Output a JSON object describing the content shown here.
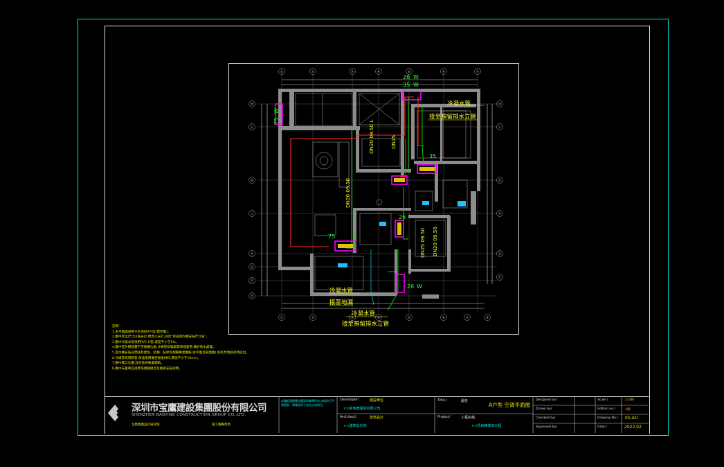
{
  "dimensions": {
    "top_total": "26",
    "top_sub": "35",
    "top_unit_mark": "W",
    "left_vert": "75",
    "left_unit_mark": "W",
    "right_bottom": "26",
    "right_bottom_mark": "W",
    "zone_mid_right": "35",
    "zone_low_left": "75",
    "zone_low_right": "26"
  },
  "grid_labels": {
    "top": [
      "①",
      "②",
      "③",
      "④",
      "⑤",
      "⑥",
      "⑦"
    ],
    "bottom": [
      "①",
      "②",
      "③",
      "④",
      "⑤",
      "⑥",
      "⑦",
      "⑧"
    ],
    "left": [
      "Ⓜ",
      "Ⓛ",
      "Ⓚ",
      "Ⓙ",
      "Ⓗ",
      "Ⓖ",
      "Ⓕ",
      "Ⓔ"
    ],
    "right": [
      "Ⓜ",
      "Ⓛ",
      "Ⓚ",
      "Ⓗ",
      "Ⓖ",
      "Ⓕ"
    ]
  },
  "plan_labels": {
    "condensate_top": "冷凝水管",
    "drain_top": "接至預留排水立管",
    "condensate_bottom": "冷凝水管",
    "drain_mid": "接至地漏",
    "condensate_bottom2": "冷凝水管",
    "drain_bottom": "接至預留排水立管",
    "pipe_vert1": "DN20 09.50 L",
    "pipe_vert2": "DN25",
    "pipe_vert3": "DN20 09.50",
    "pipe_vert4": "DN25 09.50",
    "pipe_living": "DN20 09.50"
  },
  "notes": {
    "heading": "説明:",
    "items": [
      "1.本平面図適用于本項目A户型(標準層)。",
      "2.圖中定位尺寸以毫米計,標高以米計,詳見\"空調室內機安裝尺寸表\"。",
      "3.圖中冷凝水管采用PVC-U管,坡度不小于1%。",
      "4.圖中室外機放置于空調機位處,冷媒管穿墻處需預埋套管,做好防水處理。",
      "5.室內機安裝前需核對建筑、結構、裝修等相關專業圖紙(含平面及剖面圖),如有矛盾請及時提出。",
      "6.冷媒管采用銅管,保溫采用橡塑保溫材料,厚度不小于10mm。",
      "7.圖中風口位置,詳見裝修專業圖紙。",
      "8.圖中未盡事宜請參照相關規范及廠家安裝說明。"
    ]
  },
  "titleblock": {
    "company_cn": "深圳市宝鷹建設集團股份有限公司",
    "company_en": "SHENZHEN BAOYING CONSTRUCTION GROUP CO.,LTD.",
    "company_note1": "宝鷹集團設計研究院",
    "company_note2": "施工圖專用章",
    "disclaimer": "本圖紙版權歸宝鷹建設集團所有,未經許可不得復制、傳播或用于其他工程項目。",
    "developer_label": "Developer/",
    "developer_cn": "建設單位",
    "developer_value": "××房地產開發有限公司",
    "architect_label": "Architect/",
    "architect_cn": "建筑設計",
    "architect_value": "××建筑設計院",
    "title_label": "Title /",
    "title_cn": "圖名",
    "title_value": "A户型 空调平面图",
    "project_label": "Project/",
    "project_cn": "工程名稱",
    "project_value": "××項目精裝修工程",
    "designed_label": "Designed by/",
    "drawn_label": "Drawn by/",
    "checked_label": "Checked by/",
    "approved_label": "Approved by/",
    "scale_label": "Scale /",
    "scale_value": "1:100",
    "edition_label": "Edition no./",
    "edition_value": "A版",
    "drawing_label": "Drawing No./",
    "drawing_value": "KS-AD",
    "date_label": "Date /",
    "date_value": "2022.02"
  },
  "colors": {
    "background": "#000000",
    "frame_outer": "#00e5e5",
    "frame_inner": "#ffffff",
    "wall": "#9a9a9a",
    "pipe_red": "#ff2a2a",
    "pipe_green": "#00e000",
    "unit_magenta": "#ff00ff",
    "label_yellow": "#ffff33",
    "notes_yellow": "#e8e800",
    "dim_green": "#33ff33",
    "fixture_cyan": "#20c0ff"
  }
}
